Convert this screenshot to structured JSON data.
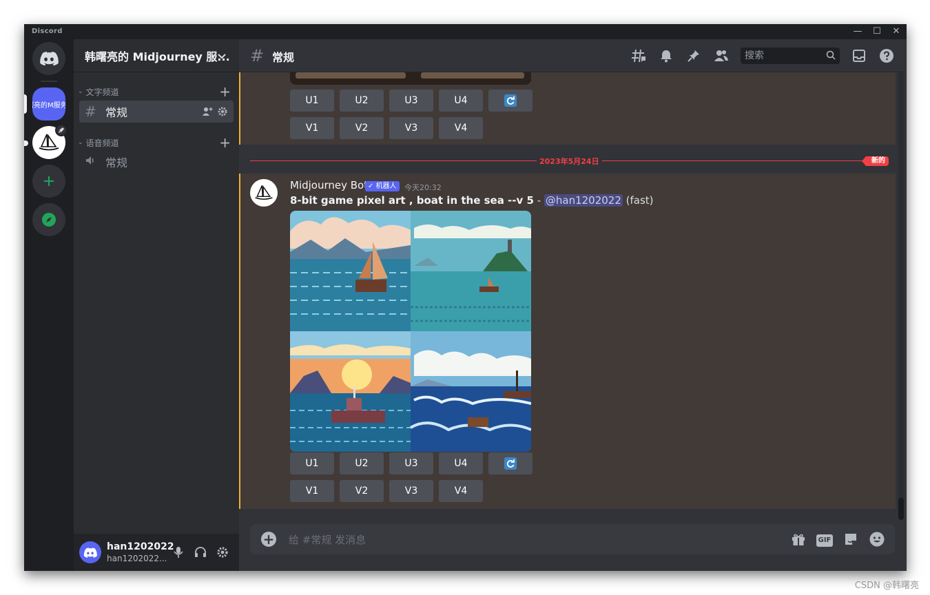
{
  "window": {
    "app_title": "Discord",
    "minimize": "—",
    "maximize": "☐",
    "close": "✕"
  },
  "rail": {
    "selected_server_label": "曙亮的M服务"
  },
  "sidebar": {
    "guild_name": "韩曙亮的 Midjourney 服...",
    "categories": [
      {
        "label": "文字频道",
        "channels": [
          {
            "label": "常规",
            "glyph": "#"
          }
        ]
      },
      {
        "label": "语音频道",
        "channels": [
          {
            "label": "常规",
            "glyph": "🔈"
          }
        ]
      }
    ],
    "user": {
      "name": "han1202022",
      "tag": "han1202022..."
    }
  },
  "header": {
    "channel_glyph": "#",
    "channel_name": "常规",
    "search_placeholder": "搜索"
  },
  "messages": {
    "first_buttons_upscale": [
      "U1",
      "U2",
      "U3",
      "U4"
    ],
    "first_buttons_variation": [
      "V1",
      "V2",
      "V3",
      "V4"
    ],
    "divider_date": "2023年5月24日",
    "new_label": "新的",
    "author": "Midjourney Bot",
    "bot_tag": "✓ 机器人",
    "timestamp": "今天20:32",
    "prompt_bold": "8-bit game pixel art , boat in the sea --v 5",
    "prompt_sep": " - ",
    "mention": "@han1202022",
    "speed": " (fast)",
    "second_buttons_upscale": [
      "U1",
      "U2",
      "U3",
      "U4"
    ],
    "second_buttons_variation": [
      "V1",
      "V2",
      "V3",
      "V4"
    ]
  },
  "composer": {
    "placeholder": "给 #常规 发消息",
    "gif_label": "GIF"
  },
  "watermark": "CSDN @韩曙亮",
  "colors": {
    "accent": "#5865f2",
    "highlight_border": "#f0b232",
    "new_divider": "#f23f43",
    "message_highlight": "#413a37"
  }
}
